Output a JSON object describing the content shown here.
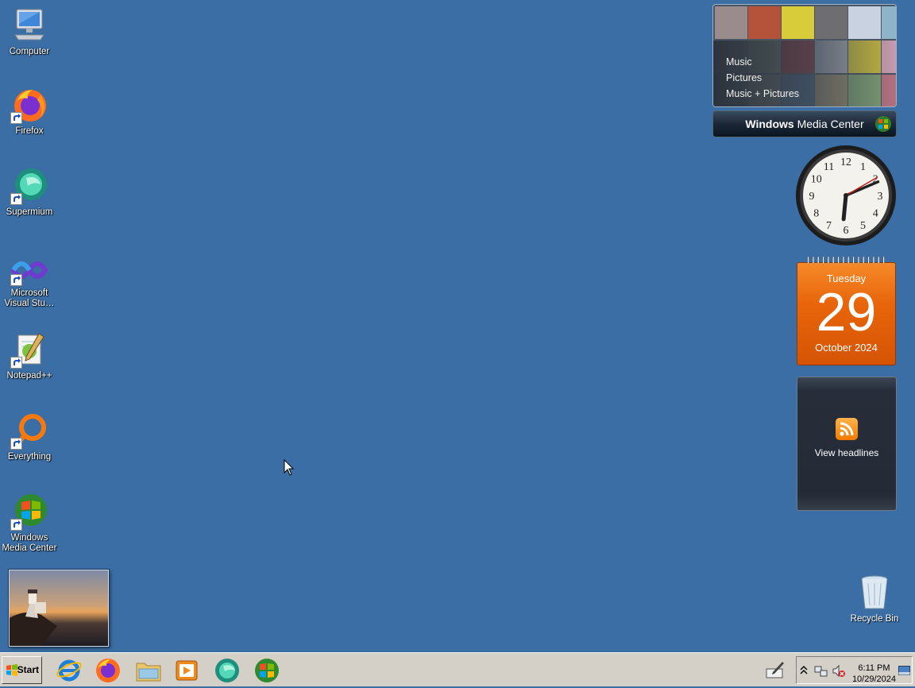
{
  "desktop": {
    "icons": [
      {
        "label": "Computer",
        "icon": "computer-icon"
      },
      {
        "label": "Firefox",
        "icon": "firefox-icon"
      },
      {
        "label": "Supermium",
        "icon": "supermium-icon"
      },
      {
        "label": "Microsoft Visual Stu…",
        "icon": "visual-studio-icon"
      },
      {
        "label": "Notepad++",
        "icon": "notepadpp-icon"
      },
      {
        "label": "Everything",
        "icon": "everything-icon"
      },
      {
        "label": "Windows Media Center",
        "icon": "media-center-icon"
      }
    ],
    "recycle_bin": {
      "label": "Recycle Bin",
      "icon": "recycle-bin-icon"
    }
  },
  "gadgets": {
    "media_center": {
      "menu": [
        "Music",
        "Pictures",
        "Music + Pictures"
      ],
      "bar_bold": "Windows",
      "bar_rest": " Media Center"
    },
    "clock": {
      "hours": 6,
      "minutes": 11,
      "seconds": 10
    },
    "calendar": {
      "day_name": "Tuesday",
      "day": "29",
      "month_year": "October 2024"
    },
    "feeds": {
      "label": "View headlines",
      "icon": "rss-icon"
    }
  },
  "taskbar": {
    "start_label": "Start",
    "pinned": [
      "internet-explorer-icon",
      "firefox-icon",
      "file-explorer-icon",
      "media-player-icon",
      "supermium-icon",
      "media-center-icon"
    ],
    "tray": {
      "time": "6:11 PM",
      "date": "10/29/2024"
    }
  },
  "colors": {
    "desktop": "#3a6ea5",
    "taskbar": "#d4d0c8",
    "calendar": "#e8650a"
  }
}
